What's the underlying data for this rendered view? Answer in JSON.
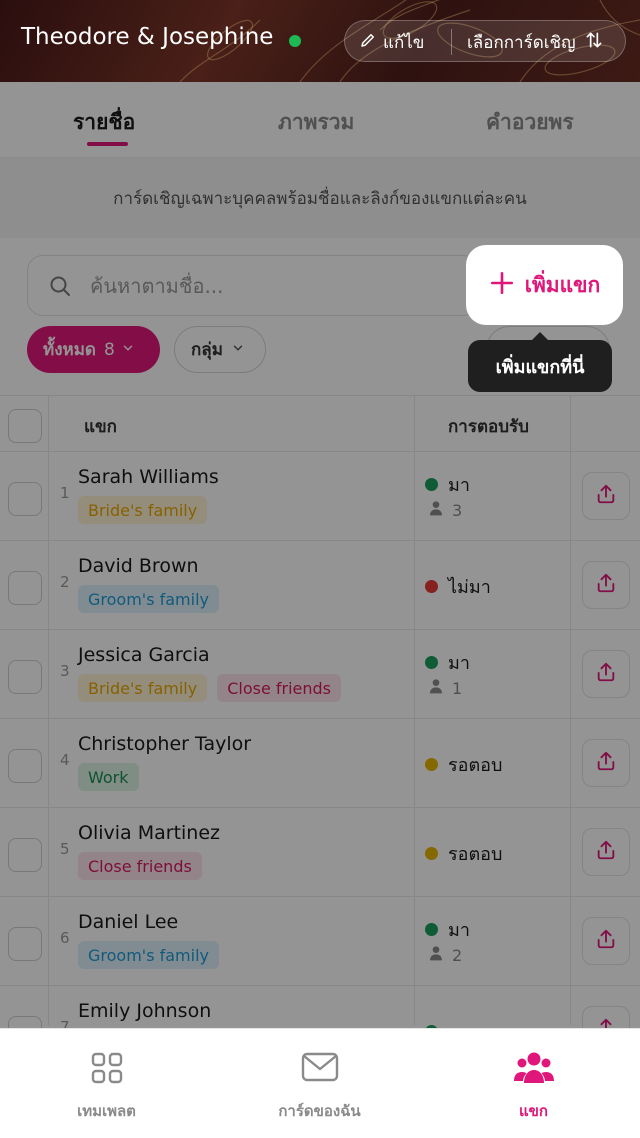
{
  "header": {
    "event_title": "Theodore & Josephine",
    "edit_label": "แก้ไข",
    "select_card_label": "เลือกการ์ดเชิญ",
    "online_color": "#1db954"
  },
  "tabs": [
    {
      "label": "รายชื่อ",
      "active": true
    },
    {
      "label": "ภาพรวม",
      "active": false
    },
    {
      "label": "คำอวยพร",
      "active": false
    }
  ],
  "description": "การ์ดเชิญเฉพาะบุคคลพร้อมชื่อและลิงก์ของแขกแต่ละคน",
  "search": {
    "placeholder": "ค้นหาตามชื่อ..."
  },
  "add_guest": {
    "label": "เพิ่มแขก",
    "tooltip": "เพิ่มแขกที่นี่"
  },
  "filters": {
    "all_label": "ทั้งหมด",
    "all_count": "8",
    "group_label": "กลุ่ม"
  },
  "table": {
    "col_guest": "แขก",
    "col_rsvp": "การตอบรับ",
    "rows": [
      {
        "num": "1",
        "name": "Sarah Williams",
        "tags": [
          "Bride's family"
        ],
        "status": "มา",
        "status_color": "green",
        "party": "3"
      },
      {
        "num": "2",
        "name": "David Brown",
        "tags": [
          "Groom's family"
        ],
        "status": "ไม่มา",
        "status_color": "red",
        "party": ""
      },
      {
        "num": "3",
        "name": "Jessica Garcia",
        "tags": [
          "Bride's family",
          "Close friends"
        ],
        "status": "มา",
        "status_color": "green",
        "party": "1"
      },
      {
        "num": "4",
        "name": "Christopher Taylor",
        "tags": [
          "Work"
        ],
        "status": "รอตอบ",
        "status_color": "yellow",
        "party": ""
      },
      {
        "num": "5",
        "name": "Olivia Martinez",
        "tags": [
          "Close friends"
        ],
        "status": "รอตอบ",
        "status_color": "yellow",
        "party": ""
      },
      {
        "num": "6",
        "name": "Daniel Lee",
        "tags": [
          "Groom's family"
        ],
        "status": "มา",
        "status_color": "green",
        "party": "2"
      },
      {
        "num": "7",
        "name": "Emily Johnson",
        "tags": [],
        "status": "มา",
        "status_color": "green",
        "party": ""
      }
    ]
  },
  "bottom_nav": [
    {
      "label": "เทมเพลต",
      "icon": "grid-icon",
      "active": false
    },
    {
      "label": "การ์ดของฉัน",
      "icon": "envelope-icon",
      "active": false
    },
    {
      "label": "แขก",
      "icon": "people-icon",
      "active": true
    }
  ],
  "colors": {
    "accent": "#e0177a",
    "header_bg": "#3d1a14"
  }
}
